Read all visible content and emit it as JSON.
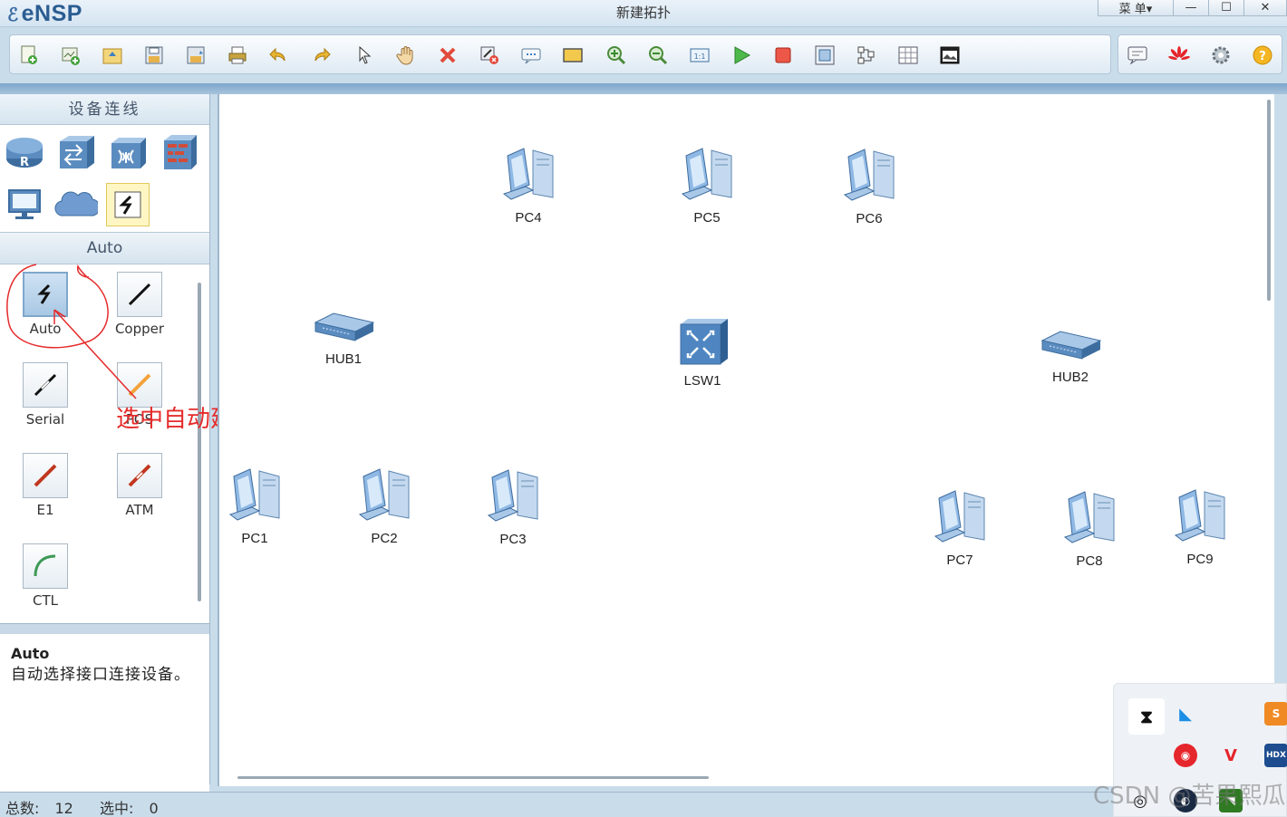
{
  "app": {
    "name": "eNSP",
    "window_title": "新建拓扑"
  },
  "window_controls": {
    "menu": "菜 单▾",
    "minimize": "—",
    "maximize": "☐",
    "close": "✕"
  },
  "toolbar": {
    "buttons": [
      "new-topology",
      "new-project",
      "open",
      "save",
      "save-as",
      "print",
      "undo",
      "redo",
      "select",
      "pan",
      "delete",
      "delete-all-links",
      "text-label",
      "rectangle",
      "zoom-in",
      "zoom-out",
      "fit-view",
      "start-device",
      "stop-device",
      "capture",
      "topology-layout",
      "grid",
      "screenshot"
    ],
    "right_buttons": [
      "feedback",
      "huawei",
      "settings",
      "help"
    ]
  },
  "sidebar": {
    "header": "设备连线",
    "device_categories": [
      "router",
      "switch",
      "wireless",
      "firewall",
      "terminal",
      "cloud",
      "connection"
    ],
    "selected_category": "connection",
    "sub_header": "Auto",
    "cables": [
      {
        "label": "Auto",
        "selected": true
      },
      {
        "label": "Copper",
        "selected": false
      },
      {
        "label": "Serial",
        "selected": false
      },
      {
        "label": "POS",
        "selected": false
      },
      {
        "label": "E1",
        "selected": false
      },
      {
        "label": "ATM",
        "selected": false
      },
      {
        "label": "CTL",
        "selected": false
      }
    ],
    "description": {
      "title": "Auto",
      "text": "自动选择接口连接设备。"
    }
  },
  "annotation": "选中自动建立连接",
  "topology": {
    "nodes": [
      {
        "name": "PC4",
        "type": "pc"
      },
      {
        "name": "PC5",
        "type": "pc"
      },
      {
        "name": "PC6",
        "type": "pc"
      },
      {
        "name": "HUB1",
        "type": "hub"
      },
      {
        "name": "LSW1",
        "type": "switch"
      },
      {
        "name": "HUB2",
        "type": "hub"
      },
      {
        "name": "PC1",
        "type": "pc"
      },
      {
        "name": "PC2",
        "type": "pc"
      },
      {
        "name": "PC3",
        "type": "pc"
      },
      {
        "name": "PC7",
        "type": "pc"
      },
      {
        "name": "PC8",
        "type": "pc"
      },
      {
        "name": "PC9",
        "type": "pc"
      }
    ]
  },
  "status": {
    "total_label": "总数:",
    "total": "12",
    "selected_label": "选中:",
    "selected": "0"
  },
  "tray": {
    "icons": [
      "bookmark-app",
      "feishu",
      "sublime",
      "netease-music",
      "vivaldi",
      "hdx",
      "wechat",
      "steam",
      "nvidia"
    ]
  },
  "watermark": "CSDN @苦果熙瓜",
  "colors": {
    "accent": "#2b5d92",
    "annotation": "#e52b2b",
    "panel": "#c9dcea"
  }
}
